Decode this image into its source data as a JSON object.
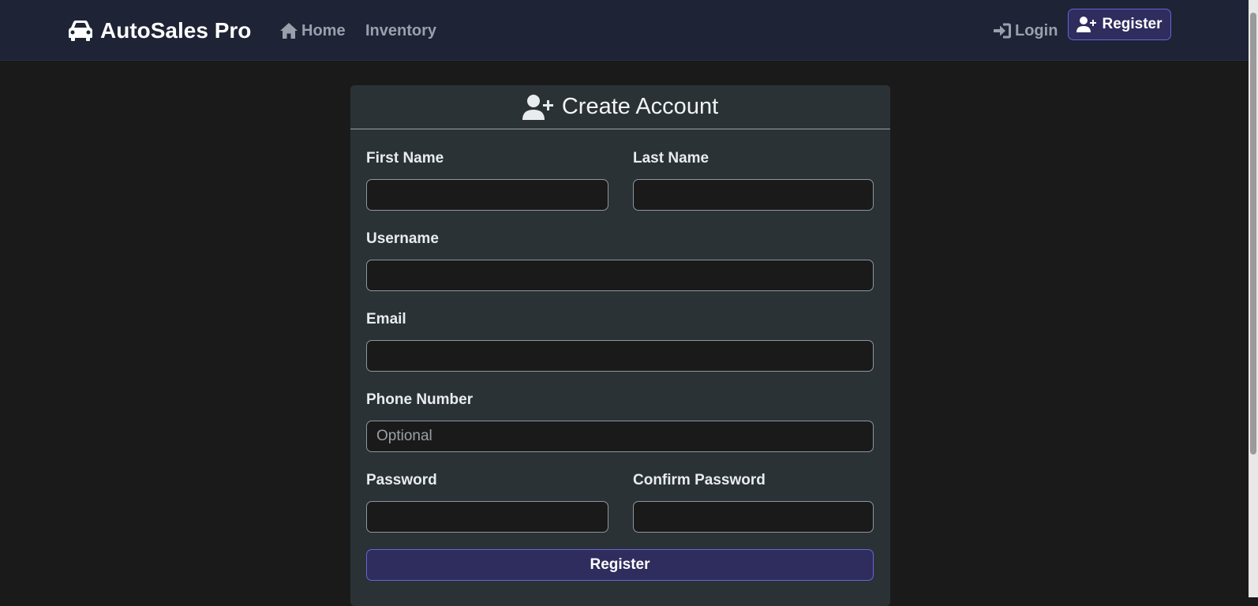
{
  "navbar": {
    "brand": "AutoSales Pro",
    "brand_icon": "car-icon",
    "links": [
      {
        "label": "Home",
        "icon": "home-icon"
      },
      {
        "label": "Inventory"
      }
    ],
    "login_label": "Login",
    "login_icon": "sign-in-icon",
    "register_label": "Register",
    "register_icon": "user-plus-icon"
  },
  "form": {
    "title": "Create Account",
    "title_icon": "user-plus-icon",
    "first_name_label": "First Name",
    "last_name_label": "Last Name",
    "username_label": "Username",
    "email_label": "Email",
    "phone_label": "Phone Number",
    "phone_placeholder": "Optional",
    "password_label": "Password",
    "confirm_password_label": "Confirm Password",
    "submit_label": "Register"
  },
  "colors": {
    "navbar_bg": "#1e2336",
    "page_bg": "#1a1a1a",
    "card_bg": "#2b3235",
    "accent_button_bg": "#2f2c5e",
    "accent_button_border": "#6b63d6"
  }
}
